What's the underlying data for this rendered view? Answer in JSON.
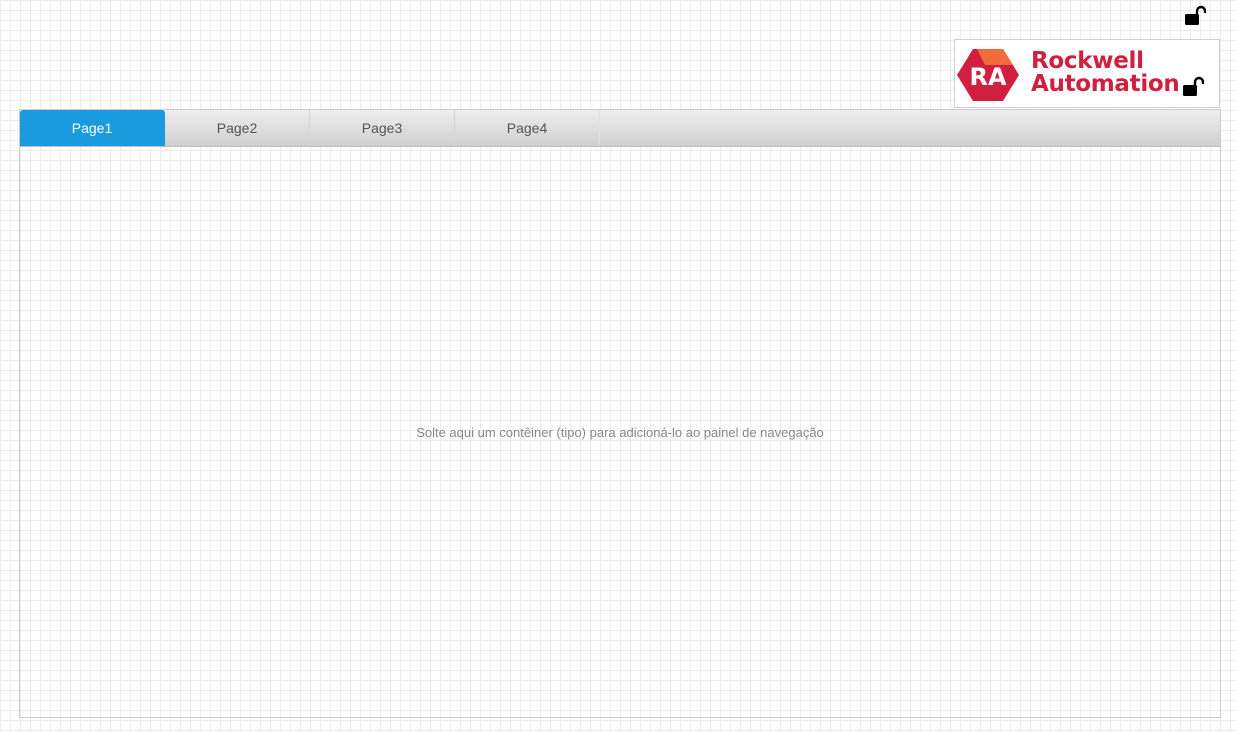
{
  "logo": {
    "mark_text": "RA",
    "line1": "Rockwell",
    "line2": "Automation",
    "brand_color": "#d11f3f",
    "accent_color": "#f26b3a"
  },
  "icons": {
    "top_lock": "unlock-icon",
    "logo_lock": "unlock-icon"
  },
  "nav": {
    "tabs": [
      {
        "label": "Page1",
        "active": true
      },
      {
        "label": "Page2",
        "active": false
      },
      {
        "label": "Page3",
        "active": false
      },
      {
        "label": "Page4",
        "active": false
      }
    ],
    "active_color": "#1a9be0",
    "drop_hint": "Solte aqui um contêiner (tipo) para adicioná-lo ao painel de navegação"
  }
}
